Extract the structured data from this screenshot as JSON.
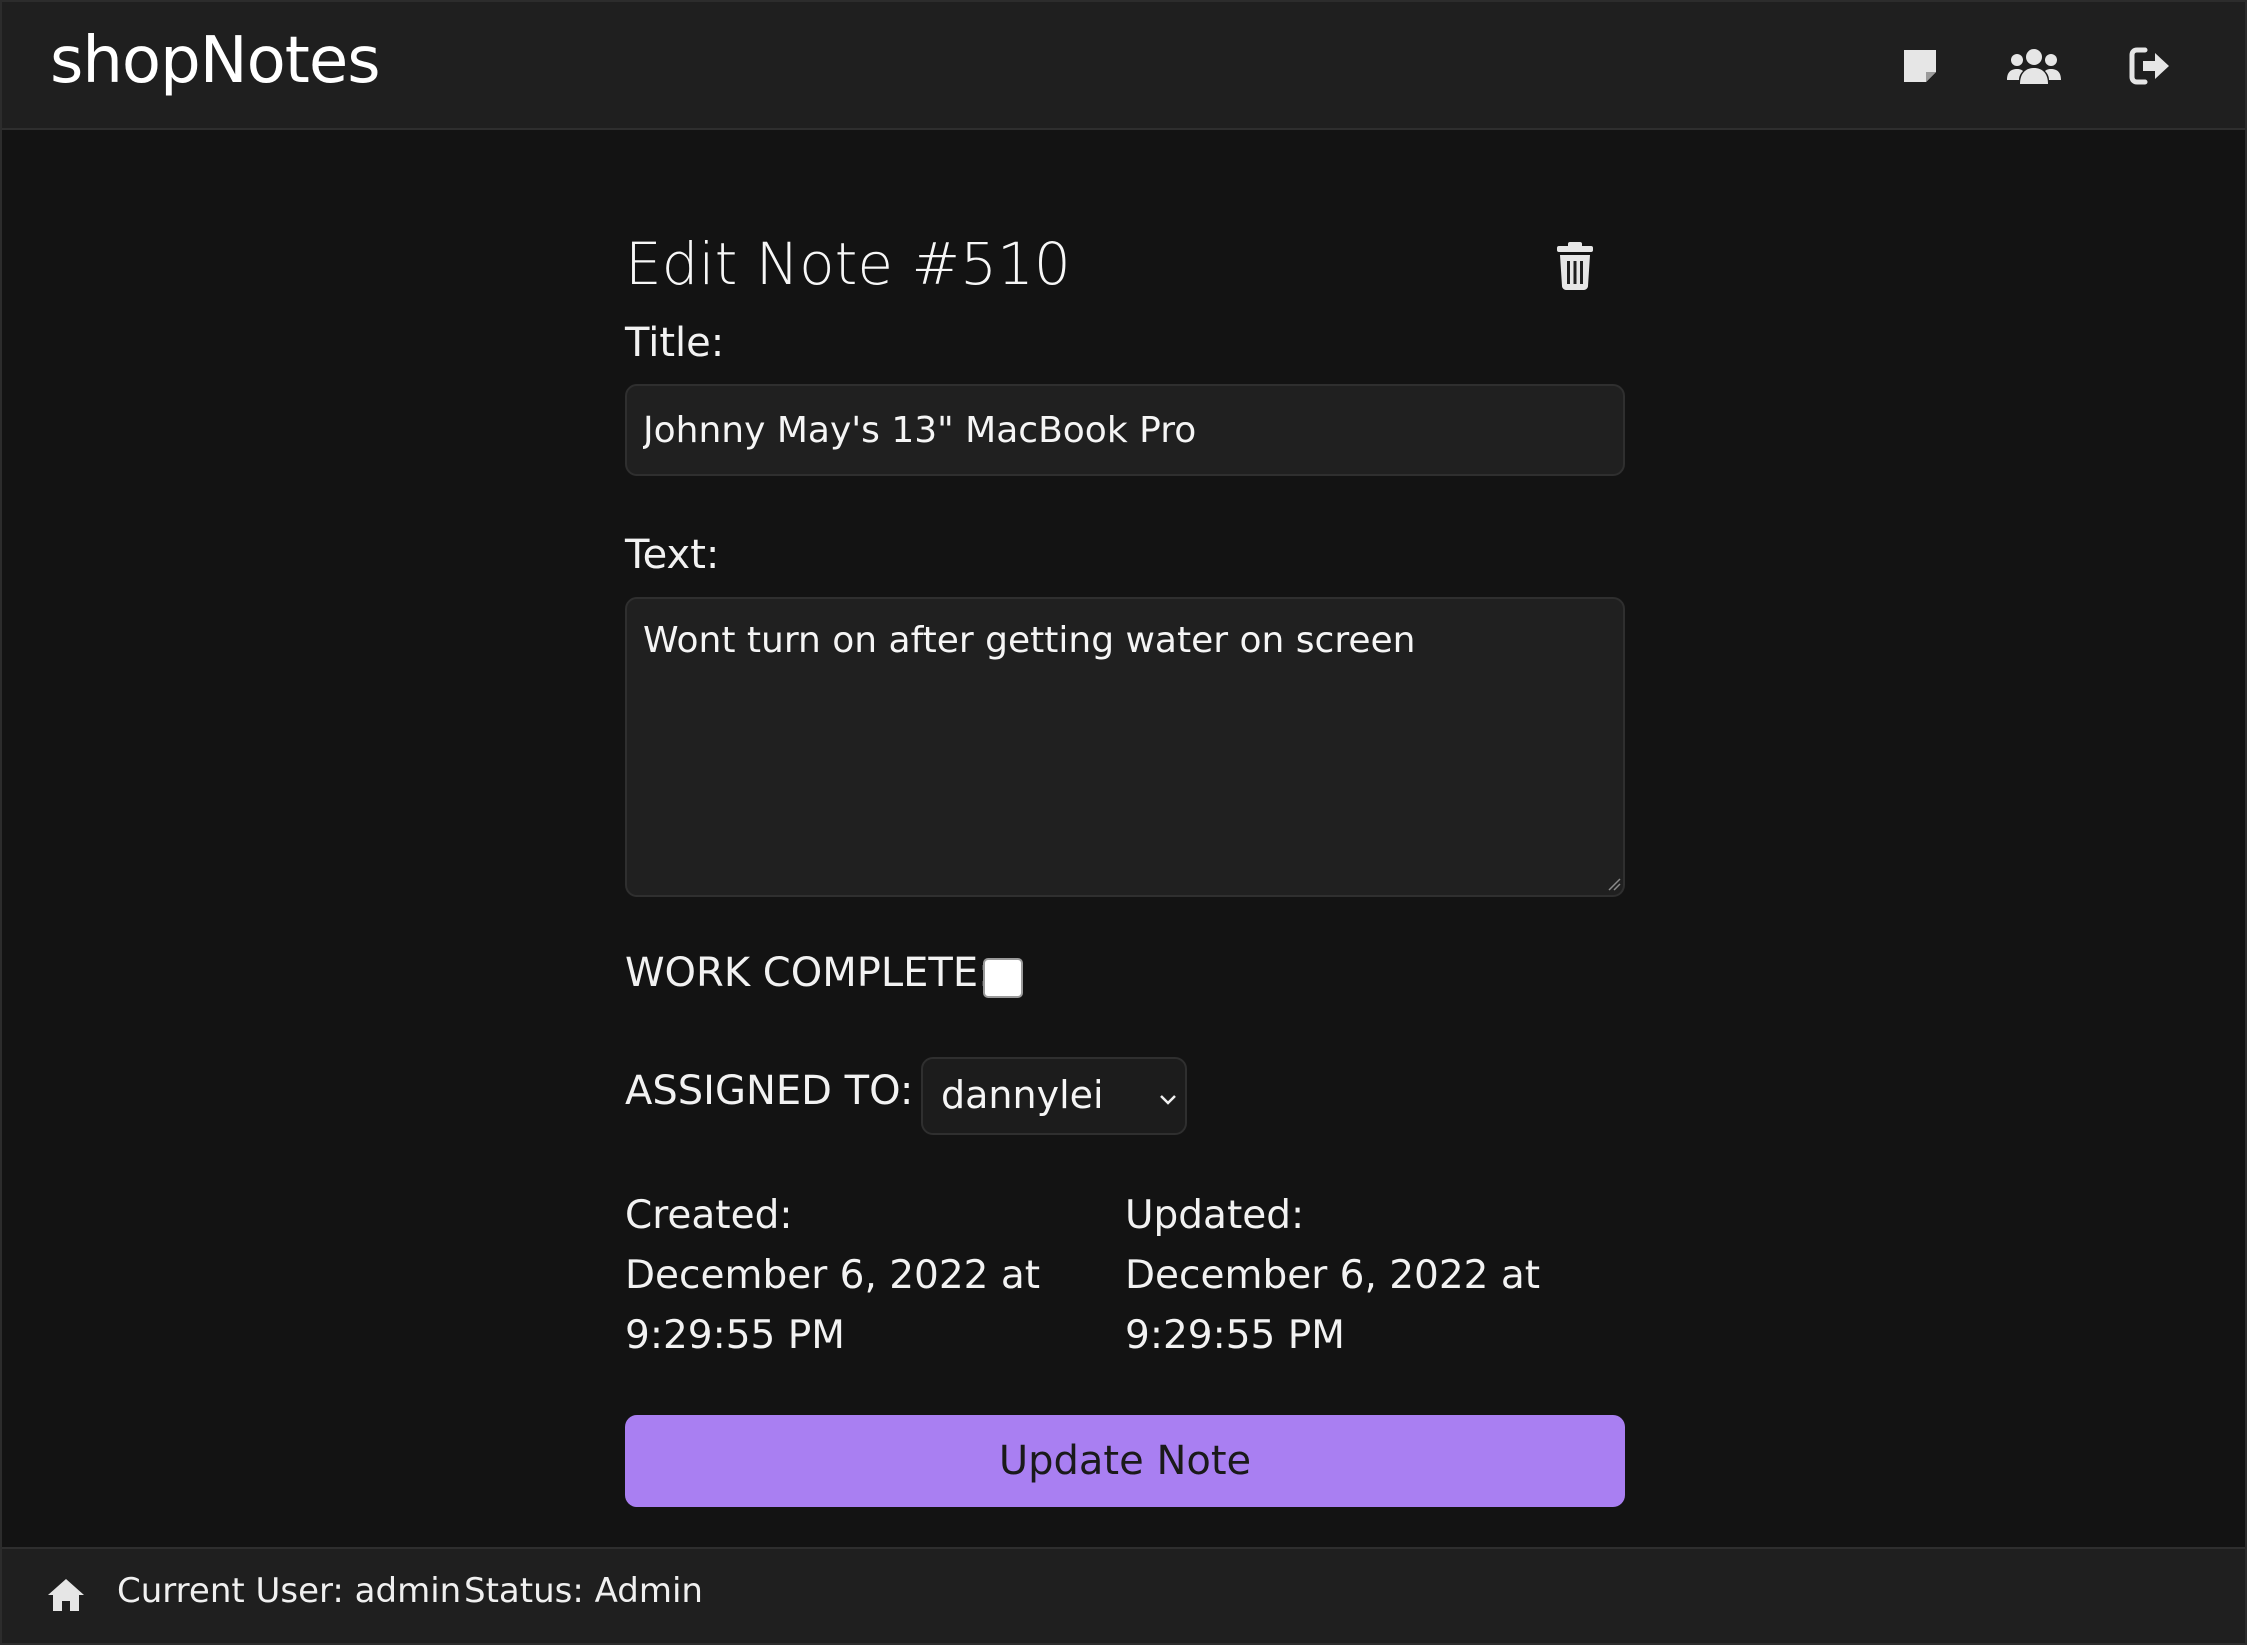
{
  "app": {
    "title": "shopNotes"
  },
  "header": {
    "icons": [
      "notes-icon",
      "users-icon",
      "logout-icon"
    ]
  },
  "form": {
    "heading": "Edit Note #510",
    "title_label": "Title:",
    "title_value": "Johnny May's 13\" MacBook Pro",
    "text_label": "Text:",
    "text_value": "Wont turn on after getting water on screen",
    "complete_label": "WORK COMPLETE:",
    "complete_checked": false,
    "assigned_label": "ASSIGNED TO:",
    "assigned_value": "dannylei",
    "created_label": "Created:",
    "created_date": "December 6, 2022 at",
    "created_time": "9:29:55 PM",
    "updated_label": "Updated:",
    "updated_date": "December 6, 2022 at",
    "updated_time": "9:29:55 PM",
    "submit_label": "Update Note"
  },
  "footer": {
    "current_user": "Current User: admin",
    "status": "Status: Admin"
  },
  "colors": {
    "accent": "#a97ff2",
    "background": "#131313",
    "panel": "#1f1f1f"
  }
}
